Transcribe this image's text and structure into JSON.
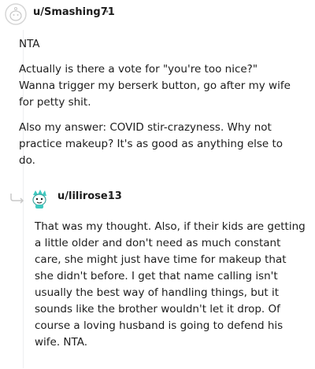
{
  "comments": [
    {
      "username": "u/Smashing71",
      "separator": "•",
      "paragraphs": [
        "NTA",
        "Actually is there a vote for \"you're too nice?\" Wanna trigger my berserk button, go after my wife for petty shit.",
        "Also my answer: COVID stir-crazyness. Why not practice makeup? It's as good as anything else to do."
      ]
    },
    {
      "username": "u/lilirose13",
      "separator": "•",
      "paragraphs": [
        "That was my thought. Also, if their kids are getting a little older and don't need as much constant care, she might just have time for makeup that she didn't before. I get that name calling isn't usually the best way of handling things, but it sounds like the brother wouldn't let it drop. Of course a loving husband is going to defend his wife. NTA."
      ]
    }
  ],
  "icons": {
    "avatar1": "default-avatar-icon",
    "avatar2": "cartoon-avatar-icon",
    "reply": "reply-arrow-icon"
  }
}
